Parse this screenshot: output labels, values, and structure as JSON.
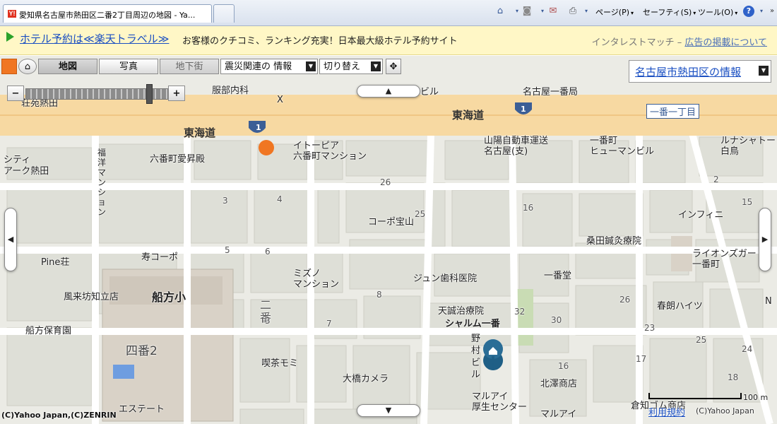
{
  "browser": {
    "tab_title": "愛知県名古屋市熱田区二番2丁目周辺の地図 - Ya...",
    "favicon": "Y!",
    "commands": {
      "page": "ページ(P)",
      "safety": "セーフティ(S)",
      "tools": "ツール(O)"
    },
    "icons": [
      "home-icon",
      "feeds-icon",
      "mail-icon",
      "print-icon",
      "help-icon"
    ]
  },
  "ad": {
    "link": "ホテル予約は≪楽天トラベル≫",
    "text": "お客様のクチコミ、ランキング充実！日本最大級ホテル予約サイト",
    "sponsor": "インタレストマッチ –",
    "sponsor_link": "広告の掲載について"
  },
  "map": {
    "view_buttons": {
      "map": "地図",
      "photo": "写真",
      "underground": "地下街"
    },
    "dropdowns": {
      "disaster": "震災関連の 情報",
      "switch": "切り替え"
    },
    "area_info_link": "名古屋市熱田区の情報",
    "scale_label": "100 m",
    "footer": {
      "copyright_left": "(C)Yahoo Japan,(C)ZENRIN",
      "terms": "利用規約",
      "copyright_right": "(C)Yahoo Japan"
    },
    "road_shield": "1",
    "zoom": {
      "minus": "−",
      "plus": "+"
    },
    "labels": {
      "tokaido_1": "東海道",
      "tokaido_2": "東海道",
      "ichiban1": "一番一丁目",
      "hattori": "服部内科",
      "x": "X",
      "biru": "ビル",
      "nagoya_ichiban_po": "名古屋一番局",
      "zentai": "荘苑熱田",
      "city_atsuta": "シティ\nアーク熱田",
      "rokuban_aishoden": "六番町愛昇殿",
      "itopia": "イトーピア\n六番町マンション",
      "sanyo": "山陽自動車運送\n名古屋(支)",
      "ichibancho_human": "一番町\nヒューマンビル",
      "lunachateau": "ルナシャトー\n白鳥",
      "fukuyo": "福\n洋\nマ\nン\nシ\nョ\nン",
      "corp_hoyama": "コーポ宝山",
      "infini": "インフィニ",
      "kuwata": "桑田鍼灸療院",
      "lions": "ライオンズガー\n一番町",
      "pine": "Pine荘",
      "kotobuki": "寿コーポ",
      "mizuno": "ミズノ\nマンション",
      "jun_dental": "ジュン歯科医院",
      "ichibandou": "一番堂",
      "furaibo": "風来坊知立店",
      "funakata_sho": "船方小",
      "funakata_hoiku": "船方保育園",
      "niban": "二\n番",
      "tensei": "天誠治療院",
      "sharmu": "シャルム一番",
      "kasugai_haitsu": "春朗ハイツ",
      "yonban": "四番2",
      "nomura": "野\n村\nビ\nル",
      "kissa_momi": "喫茶モミ",
      "ohashi_camera": "大橋カメラ",
      "kitazawa": "北澤商店",
      "marui_kosei": "マルアイ\n厚生センター",
      "marui": "マルアイ",
      "kurachi": "倉知ゴム商店",
      "estate": "エステート",
      "n": "N"
    },
    "block_numbers": [
      "3",
      "4",
      "26",
      "25",
      "16",
      "5",
      "6",
      "8",
      "7",
      "32",
      "30",
      "26",
      "23",
      "25",
      "24",
      "17",
      "16",
      "18",
      "15",
      "2",
      "3"
    ]
  }
}
